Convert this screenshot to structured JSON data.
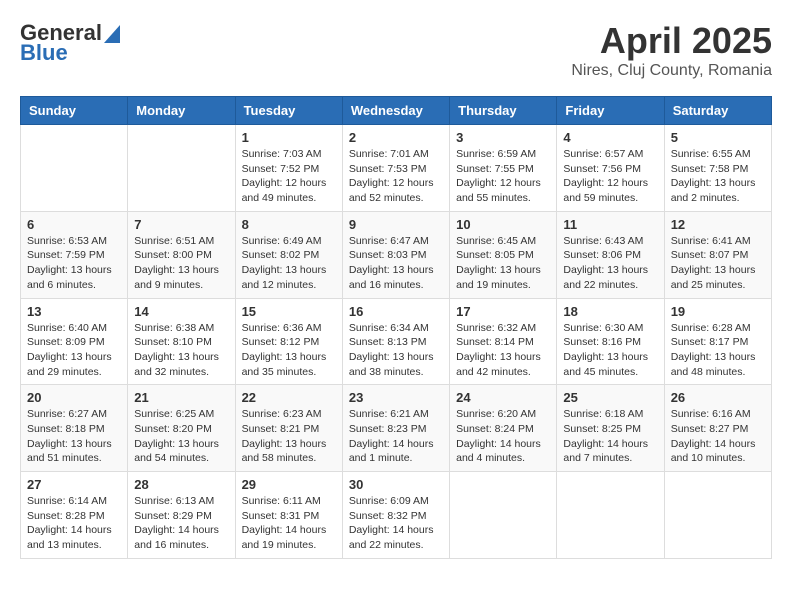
{
  "logo": {
    "general": "General",
    "blue": "Blue"
  },
  "title": "April 2025",
  "location": "Nires, Cluj County, Romania",
  "days_of_week": [
    "Sunday",
    "Monday",
    "Tuesday",
    "Wednesday",
    "Thursday",
    "Friday",
    "Saturday"
  ],
  "weeks": [
    [
      {
        "day": "",
        "info": ""
      },
      {
        "day": "",
        "info": ""
      },
      {
        "day": "1",
        "info": "Sunrise: 7:03 AM\nSunset: 7:52 PM\nDaylight: 12 hours and 49 minutes."
      },
      {
        "day": "2",
        "info": "Sunrise: 7:01 AM\nSunset: 7:53 PM\nDaylight: 12 hours and 52 minutes."
      },
      {
        "day": "3",
        "info": "Sunrise: 6:59 AM\nSunset: 7:55 PM\nDaylight: 12 hours and 55 minutes."
      },
      {
        "day": "4",
        "info": "Sunrise: 6:57 AM\nSunset: 7:56 PM\nDaylight: 12 hours and 59 minutes."
      },
      {
        "day": "5",
        "info": "Sunrise: 6:55 AM\nSunset: 7:58 PM\nDaylight: 13 hours and 2 minutes."
      }
    ],
    [
      {
        "day": "6",
        "info": "Sunrise: 6:53 AM\nSunset: 7:59 PM\nDaylight: 13 hours and 6 minutes."
      },
      {
        "day": "7",
        "info": "Sunrise: 6:51 AM\nSunset: 8:00 PM\nDaylight: 13 hours and 9 minutes."
      },
      {
        "day": "8",
        "info": "Sunrise: 6:49 AM\nSunset: 8:02 PM\nDaylight: 13 hours and 12 minutes."
      },
      {
        "day": "9",
        "info": "Sunrise: 6:47 AM\nSunset: 8:03 PM\nDaylight: 13 hours and 16 minutes."
      },
      {
        "day": "10",
        "info": "Sunrise: 6:45 AM\nSunset: 8:05 PM\nDaylight: 13 hours and 19 minutes."
      },
      {
        "day": "11",
        "info": "Sunrise: 6:43 AM\nSunset: 8:06 PM\nDaylight: 13 hours and 22 minutes."
      },
      {
        "day": "12",
        "info": "Sunrise: 6:41 AM\nSunset: 8:07 PM\nDaylight: 13 hours and 25 minutes."
      }
    ],
    [
      {
        "day": "13",
        "info": "Sunrise: 6:40 AM\nSunset: 8:09 PM\nDaylight: 13 hours and 29 minutes."
      },
      {
        "day": "14",
        "info": "Sunrise: 6:38 AM\nSunset: 8:10 PM\nDaylight: 13 hours and 32 minutes."
      },
      {
        "day": "15",
        "info": "Sunrise: 6:36 AM\nSunset: 8:12 PM\nDaylight: 13 hours and 35 minutes."
      },
      {
        "day": "16",
        "info": "Sunrise: 6:34 AM\nSunset: 8:13 PM\nDaylight: 13 hours and 38 minutes."
      },
      {
        "day": "17",
        "info": "Sunrise: 6:32 AM\nSunset: 8:14 PM\nDaylight: 13 hours and 42 minutes."
      },
      {
        "day": "18",
        "info": "Sunrise: 6:30 AM\nSunset: 8:16 PM\nDaylight: 13 hours and 45 minutes."
      },
      {
        "day": "19",
        "info": "Sunrise: 6:28 AM\nSunset: 8:17 PM\nDaylight: 13 hours and 48 minutes."
      }
    ],
    [
      {
        "day": "20",
        "info": "Sunrise: 6:27 AM\nSunset: 8:18 PM\nDaylight: 13 hours and 51 minutes."
      },
      {
        "day": "21",
        "info": "Sunrise: 6:25 AM\nSunset: 8:20 PM\nDaylight: 13 hours and 54 minutes."
      },
      {
        "day": "22",
        "info": "Sunrise: 6:23 AM\nSunset: 8:21 PM\nDaylight: 13 hours and 58 minutes."
      },
      {
        "day": "23",
        "info": "Sunrise: 6:21 AM\nSunset: 8:23 PM\nDaylight: 14 hours and 1 minute."
      },
      {
        "day": "24",
        "info": "Sunrise: 6:20 AM\nSunset: 8:24 PM\nDaylight: 14 hours and 4 minutes."
      },
      {
        "day": "25",
        "info": "Sunrise: 6:18 AM\nSunset: 8:25 PM\nDaylight: 14 hours and 7 minutes."
      },
      {
        "day": "26",
        "info": "Sunrise: 6:16 AM\nSunset: 8:27 PM\nDaylight: 14 hours and 10 minutes."
      }
    ],
    [
      {
        "day": "27",
        "info": "Sunrise: 6:14 AM\nSunset: 8:28 PM\nDaylight: 14 hours and 13 minutes."
      },
      {
        "day": "28",
        "info": "Sunrise: 6:13 AM\nSunset: 8:29 PM\nDaylight: 14 hours and 16 minutes."
      },
      {
        "day": "29",
        "info": "Sunrise: 6:11 AM\nSunset: 8:31 PM\nDaylight: 14 hours and 19 minutes."
      },
      {
        "day": "30",
        "info": "Sunrise: 6:09 AM\nSunset: 8:32 PM\nDaylight: 14 hours and 22 minutes."
      },
      {
        "day": "",
        "info": ""
      },
      {
        "day": "",
        "info": ""
      },
      {
        "day": "",
        "info": ""
      }
    ]
  ]
}
